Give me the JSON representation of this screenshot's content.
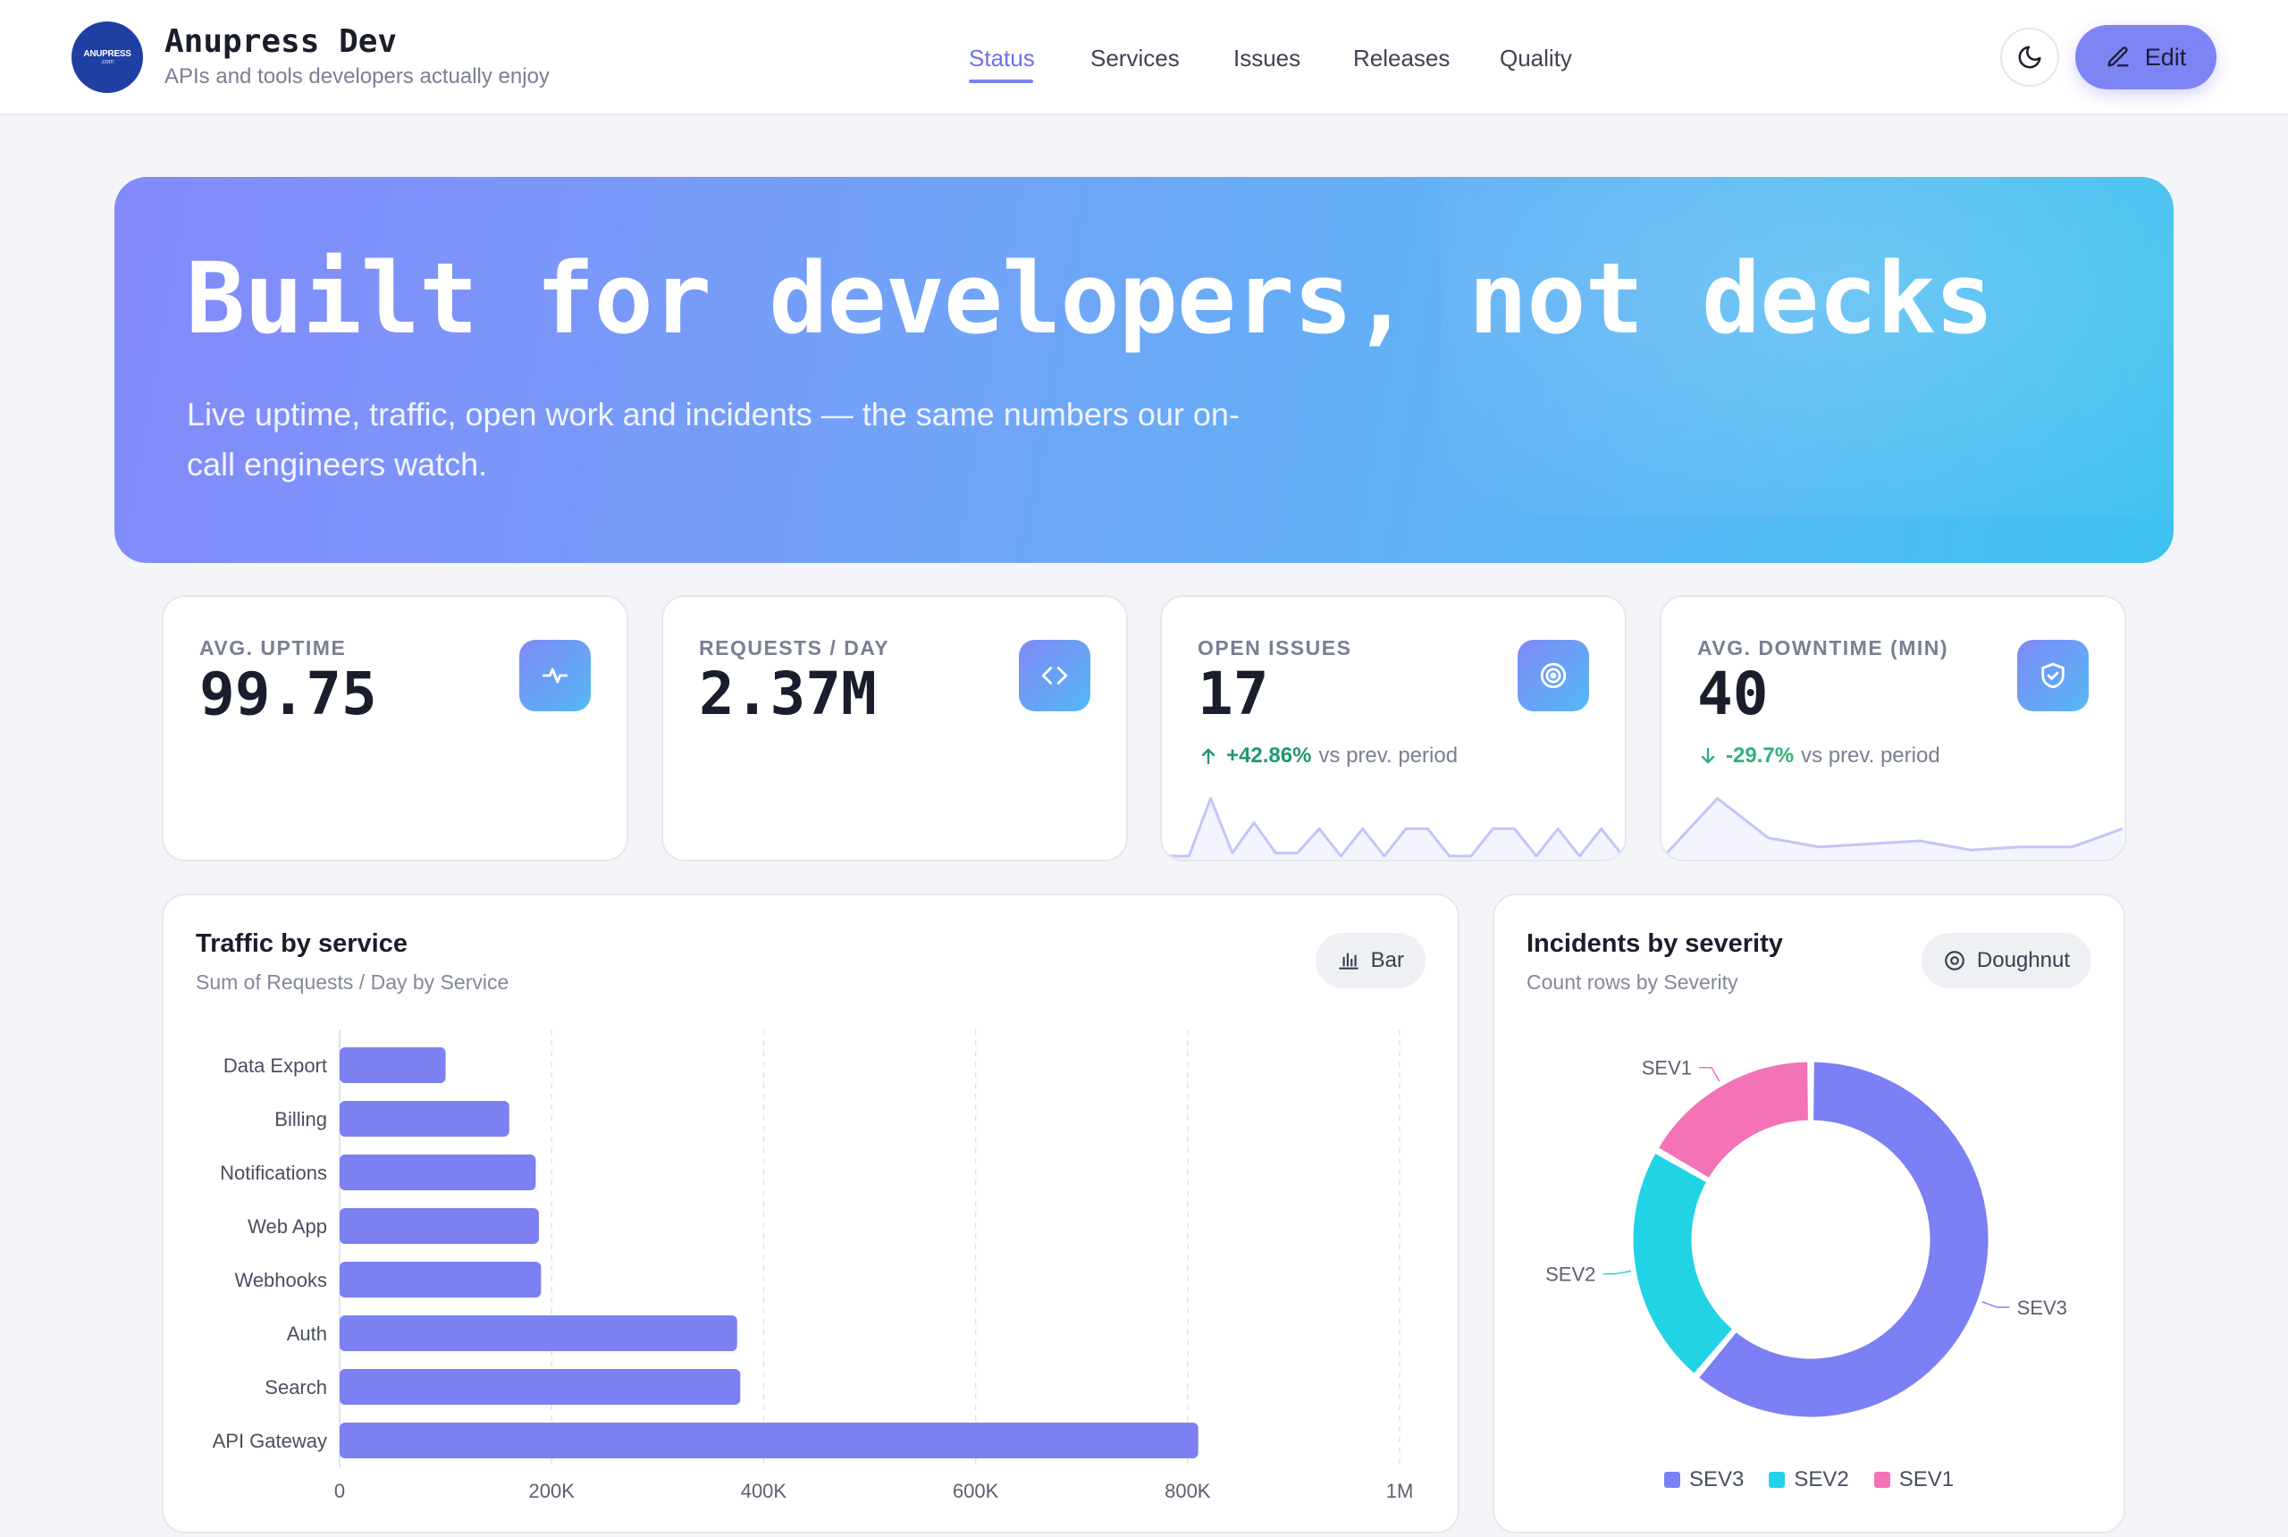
{
  "header": {
    "logo_text": "ANUPRESS",
    "logo_sub": ".com",
    "brand_name": "Anupress Dev",
    "tagline": "APIs and tools developers actually enjoy",
    "nav": [
      {
        "label": "Status",
        "active": true
      },
      {
        "label": "Services",
        "active": false
      },
      {
        "label": "Issues",
        "active": false
      },
      {
        "label": "Releases",
        "active": false
      },
      {
        "label": "Quality",
        "active": false
      }
    ],
    "theme_icon": "moon-icon",
    "edit_label": "Edit",
    "edit_icon": "pencil-icon"
  },
  "hero": {
    "title": "Built for developers, not decks",
    "subtitle": "Live uptime, traffic, open work and incidents — the same numbers our on-call engineers watch."
  },
  "kpis": [
    {
      "label": "AVG. UPTIME",
      "value": "99.75",
      "icon": "activity-icon"
    },
    {
      "label": "REQUESTS / DAY",
      "value": "2.37M",
      "icon": "code-icon"
    },
    {
      "label": "OPEN ISSUES",
      "value": "17",
      "icon": "target-icon",
      "delta": "+42.86%",
      "delta_suffix": "vs prev. period",
      "delta_direction": "up",
      "delta_color": "#1f9a6a",
      "sparkline": [
        0.0,
        0.0,
        0.95,
        0.05,
        0.55,
        0.05,
        0.05,
        0.45,
        0.0,
        0.45,
        0.0,
        0.45,
        0.45,
        0.0,
        0.0,
        0.45,
        0.45,
        0.0,
        0.45,
        0.0,
        0.45,
        0.0
      ]
    },
    {
      "label": "AVG. DOWNTIME (MIN)",
      "value": "40",
      "icon": "shield-check-icon",
      "delta": "-29.7%",
      "delta_suffix": "vs prev. period",
      "delta_direction": "down",
      "delta_color": "#2fb27a",
      "sparkline": [
        0.05,
        0.95,
        0.3,
        0.15,
        0.2,
        0.25,
        0.1,
        0.15,
        0.15,
        0.45
      ]
    }
  ],
  "traffic_panel": {
    "title": "Traffic by service",
    "subtitle": "Sum of Requests / Day by Service",
    "chip_label": "Bar",
    "chip_icon": "bar-chart-icon"
  },
  "incidents_panel": {
    "title": "Incidents by severity",
    "subtitle": "Count rows by Severity",
    "chip_label": "Doughnut",
    "chip_icon": "doughnut-icon"
  },
  "chart_data": [
    {
      "type": "bar",
      "orientation": "horizontal",
      "categories": [
        "Data Export",
        "Billing",
        "Notifications",
        "Web App",
        "Webhooks",
        "Auth",
        "Search",
        "API Gateway"
      ],
      "values": [
        100000,
        160000,
        185000,
        188000,
        190000,
        375000,
        378000,
        810000
      ],
      "xlim": [
        0,
        1000000
      ],
      "xticks": [
        0,
        200000,
        400000,
        600000,
        800000,
        1000000
      ],
      "xtick_labels": [
        "0",
        "200K",
        "400K",
        "600K",
        "800K",
        "1M"
      ],
      "color": "#7c80f2",
      "grid": true
    },
    {
      "type": "doughnut",
      "categories": [
        "SEV3",
        "SEV2",
        "SEV1"
      ],
      "values": [
        11,
        4,
        3
      ],
      "colors": [
        "#7c80f4",
        "#22d3e6",
        "#f472b6"
      ],
      "legend": "bottom"
    }
  ]
}
